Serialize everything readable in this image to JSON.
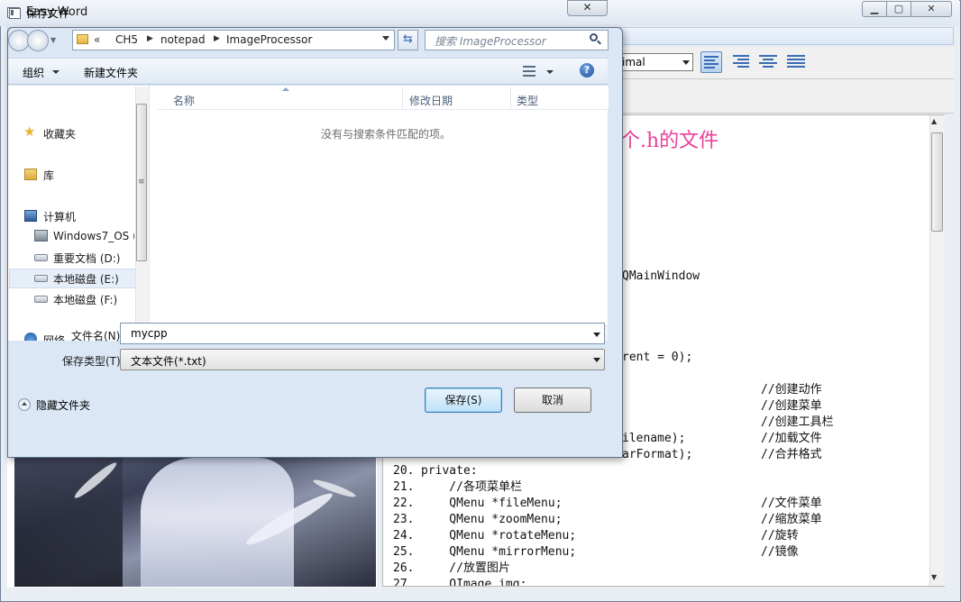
{
  "app": {
    "title": "Easy Word"
  },
  "toolbar": {
    "font_combo": "imal"
  },
  "editor": {
    "heading_fragment": "个.h的文件",
    "lines": [
      {
        "num": "",
        "code": "QMainWindow",
        "comment": ""
      },
      {
        "num": "",
        "code": "rent = 0);",
        "comment": ""
      },
      {
        "num": "",
        "code": "",
        "comment": "//创建动作"
      },
      {
        "num": "",
        "code": "",
        "comment": "//创建菜单"
      },
      {
        "num": "",
        "code": "",
        "comment": "//创建工具栏"
      },
      {
        "num": "",
        "code": "ilename);",
        "comment": "//加载文件"
      },
      {
        "num": "",
        "code": "arFormat);",
        "comment": "//合并格式"
      },
      {
        "num": "20.",
        "code": "private:",
        "comment": ""
      },
      {
        "num": "21.",
        "code": "    //各项菜单栏",
        "comment": ""
      },
      {
        "num": "22.",
        "code": "    QMenu *fileMenu;",
        "comment": "//文件菜单"
      },
      {
        "num": "23.",
        "code": "    QMenu *zoomMenu;",
        "comment": "//缩放菜单"
      },
      {
        "num": "24.",
        "code": "    QMenu *rotateMenu;",
        "comment": "//旋转"
      },
      {
        "num": "25.",
        "code": "    QMenu *mirrorMenu;",
        "comment": "//镜像"
      },
      {
        "num": "26.",
        "code": "    //放置图片",
        "comment": ""
      },
      {
        "num": "27.",
        "code": "    QImage img;",
        "comment": ""
      }
    ]
  },
  "dialog": {
    "title": "保存文件",
    "close": "✕",
    "address": {
      "chev": "«",
      "crumbs": [
        "CH5",
        "notepad",
        "ImageProcessor"
      ]
    },
    "search_placeholder": "搜索 ImageProcessor",
    "commands": {
      "organize": "组织",
      "new_folder": "新建文件夹",
      "help": "?"
    },
    "nav": {
      "favorites": "收藏夹",
      "libraries": "库",
      "computer": "计算机",
      "drives": [
        "Windows7_OS (",
        "重要文档 (D:)",
        "本地磁盘 (E:)",
        "本地磁盘 (F:)"
      ],
      "network": "网络"
    },
    "columns": {
      "name": "名称",
      "date": "修改日期",
      "type": "类型"
    },
    "empty_message": "没有与搜索条件匹配的项。",
    "filename_label": "文件名(N):",
    "filename_value": "mycpp",
    "filetype_label": "保存类型(T):",
    "filetype_value": "文本文件(*.txt)",
    "hide_folders": "隐藏文件夹",
    "save_button": "保存(S)",
    "cancel_button": "取消"
  },
  "icons": {
    "app": "window-icon",
    "back": "back-arrow-icon",
    "forward": "forward-arrow-icon",
    "refresh": "refresh-icon",
    "search": "search-icon",
    "help": "help-icon",
    "favorites": "star-icon",
    "computer": "computer-icon",
    "drive": "drive-icon",
    "network": "network-icon"
  }
}
